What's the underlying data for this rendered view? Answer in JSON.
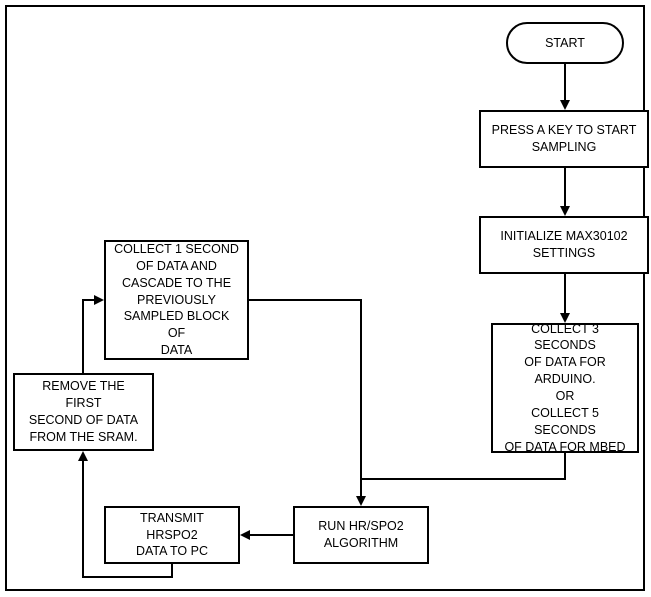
{
  "nodes": {
    "start": "START",
    "press_key": "PRESS A KEY TO START\nSAMPLING",
    "init": "INITIALIZE MAX30102\nSETTINGS",
    "collect_initial": "COLLECT 3 SECONDS\nOF DATA FOR\nARDUINO.\nOR\nCOLLECT 5 SECONDS\nOF DATA FOR MBED",
    "run_algo": "RUN HR/SPO2\nALGORITHM",
    "transmit": "TRANSMIT HRSPO2\nDATA TO PC",
    "remove": "REMOVE THE FIRST\nSECOND OF DATA\nFROM THE SRAM.",
    "collect_one": "COLLECT 1 SECOND\nOF DATA AND\nCASCADE TO THE\nPREVIOUSLY\nSAMPLED BLOCK OF\nDATA"
  }
}
